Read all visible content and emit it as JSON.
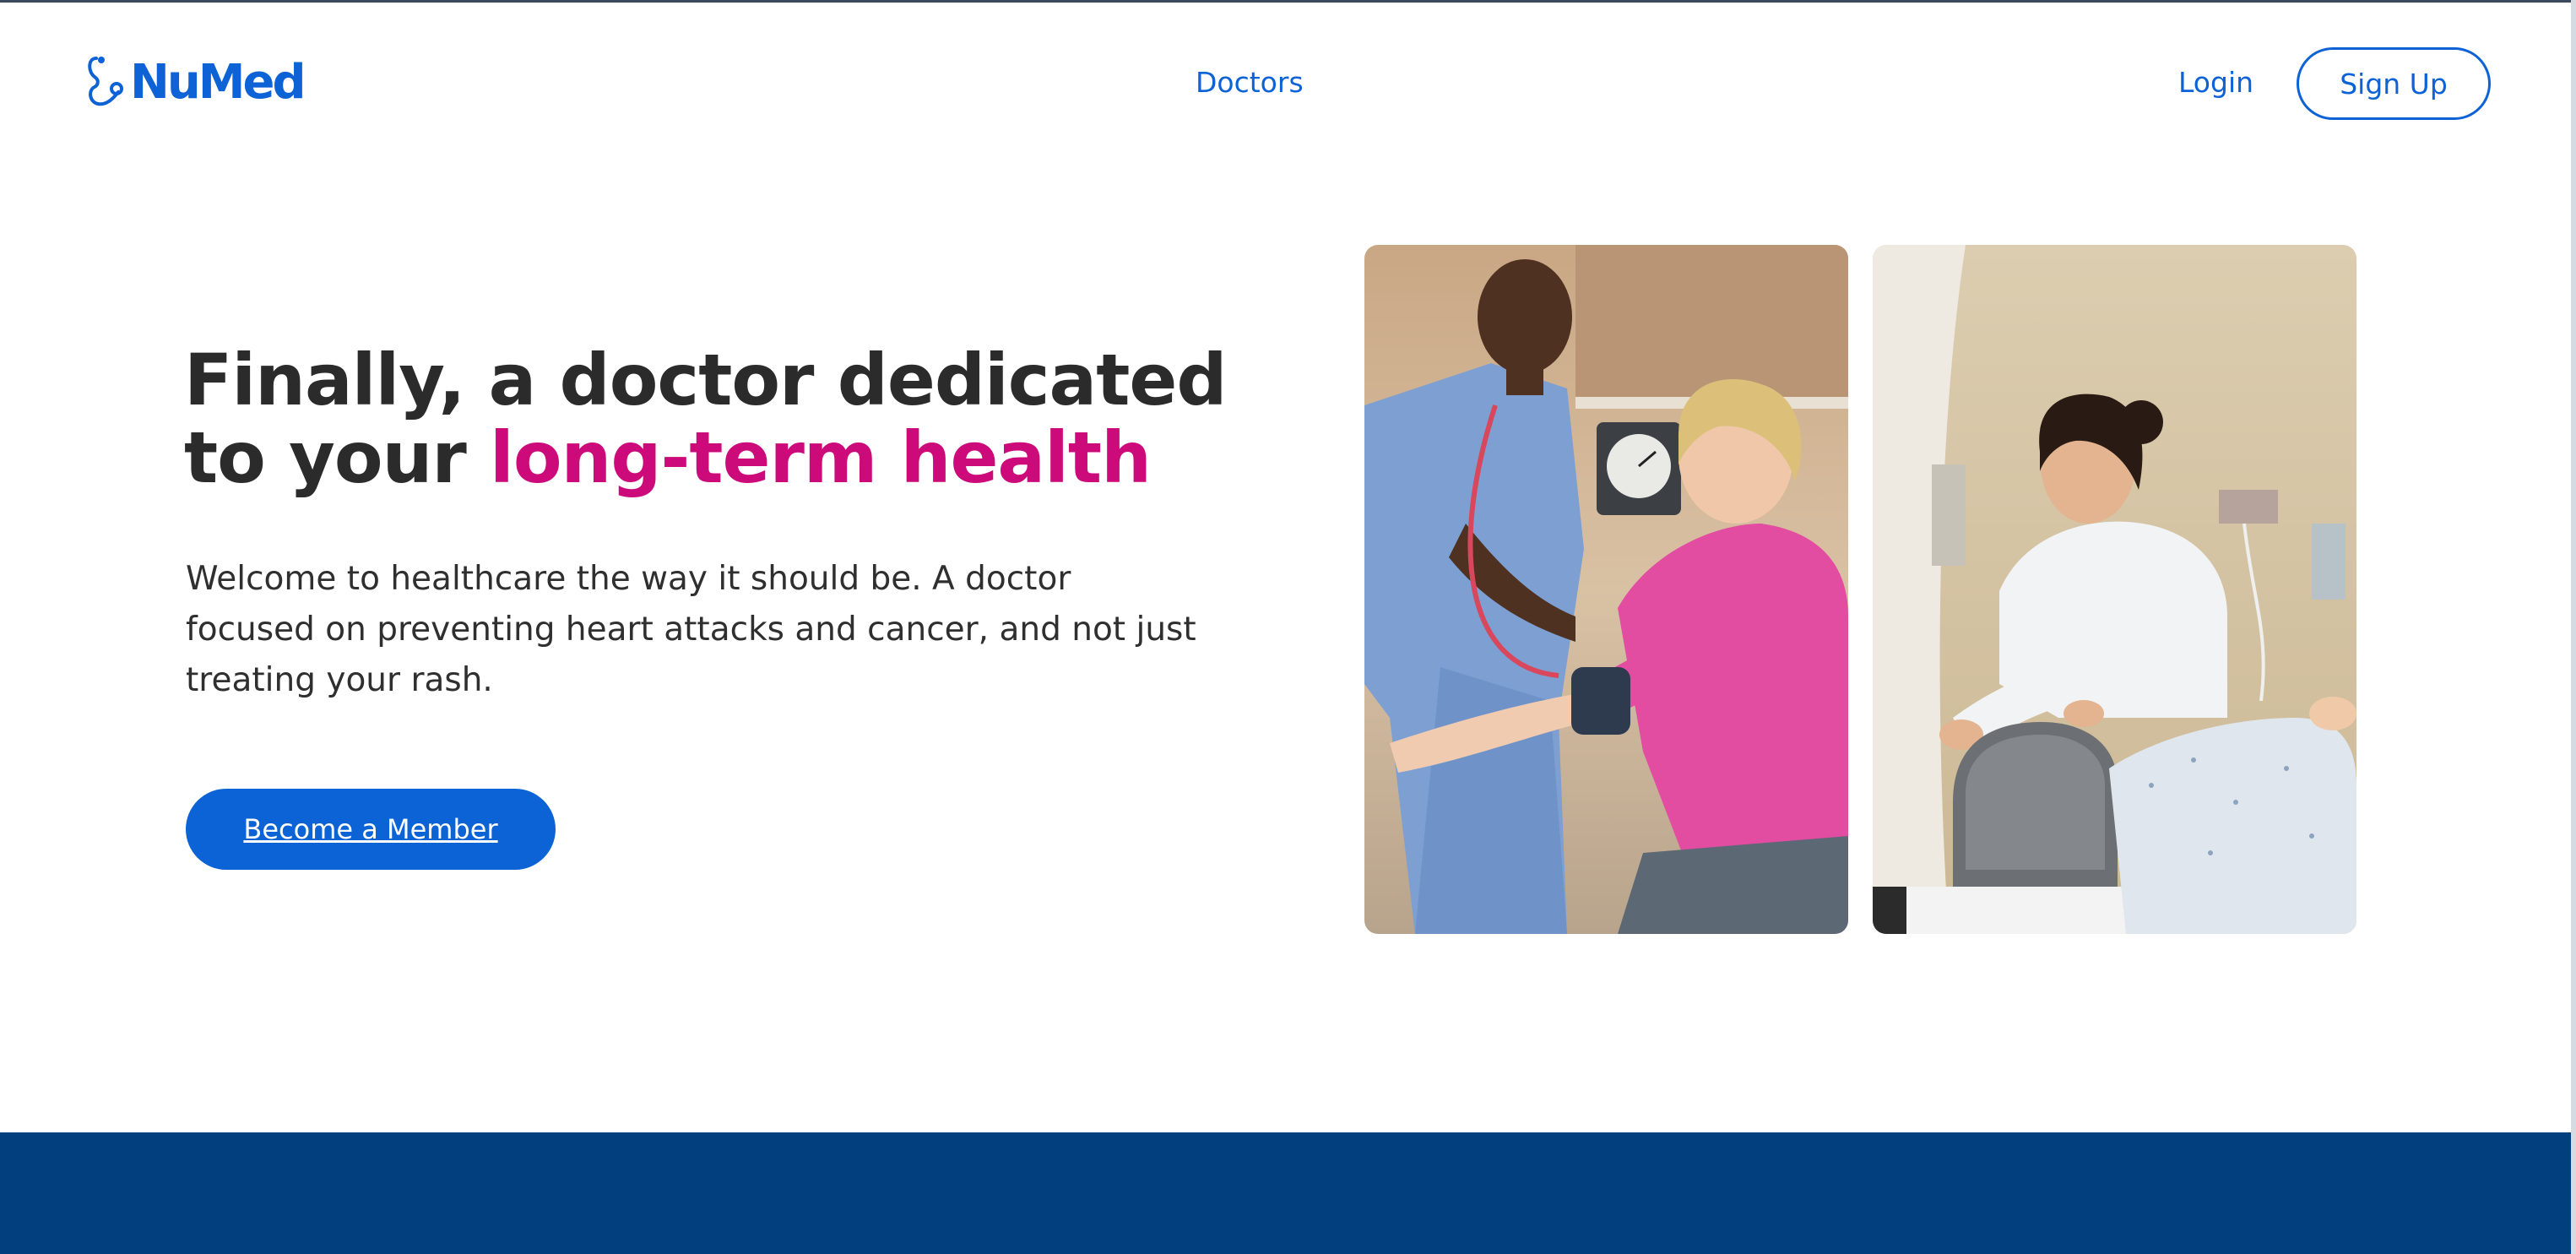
{
  "brand": {
    "name": "NuMed",
    "logo_icon": "stethoscope-icon",
    "color": "#0d62d6"
  },
  "nav": {
    "doctors_label": "Doctors",
    "login_label": "Login",
    "signup_label": "Sign Up"
  },
  "hero": {
    "title_part1": "Finally, a doctor dedicated",
    "title_part2": "to your ",
    "title_accent": "long-term health",
    "subtitle": "Welcome to healthcare the way it should be. A doctor focused on preventing heart attacks and cancer, and not just treating your rash.",
    "cta_label": "Become a Member",
    "accent_color": "#cc0a7a"
  },
  "images": [
    {
      "name": "doctor-checking-blood-pressure-photo"
    },
    {
      "name": "doctor-preparing-patient-mask-photo"
    }
  ],
  "colors": {
    "primary": "#0d62d6",
    "footer": "#023f7f",
    "text": "#2b2b2b"
  }
}
